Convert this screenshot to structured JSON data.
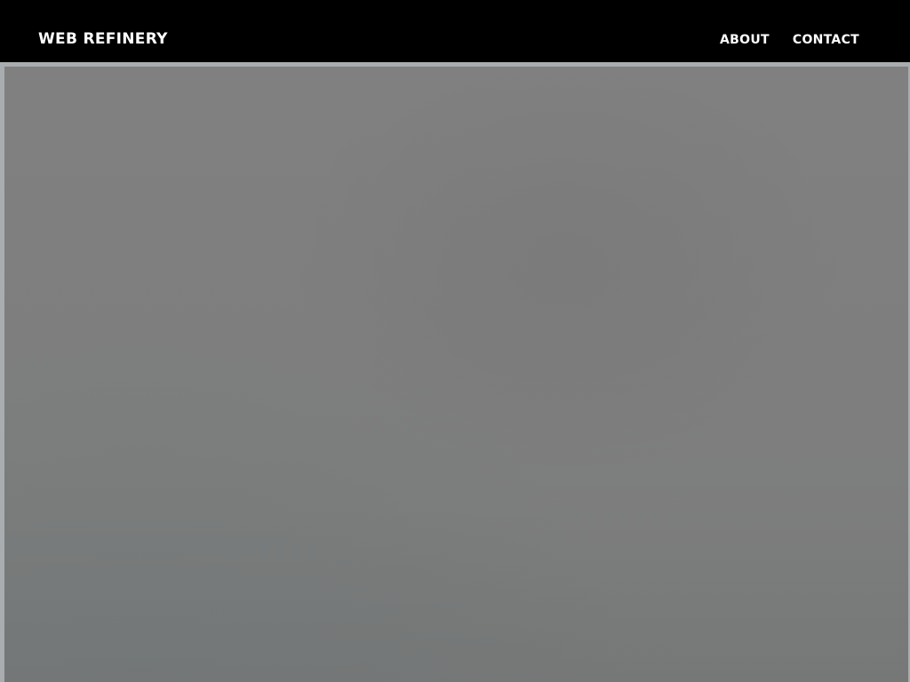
{
  "header": {
    "brand": "WEB REFINERY",
    "nav": [
      {
        "label": "ABOUT"
      },
      {
        "label": "CONTACT"
      }
    ]
  },
  "colors": {
    "header_background": "#000000",
    "header_text": "#ffffff",
    "hero_frame": "#a9adaf",
    "hero_image": "#808080"
  }
}
